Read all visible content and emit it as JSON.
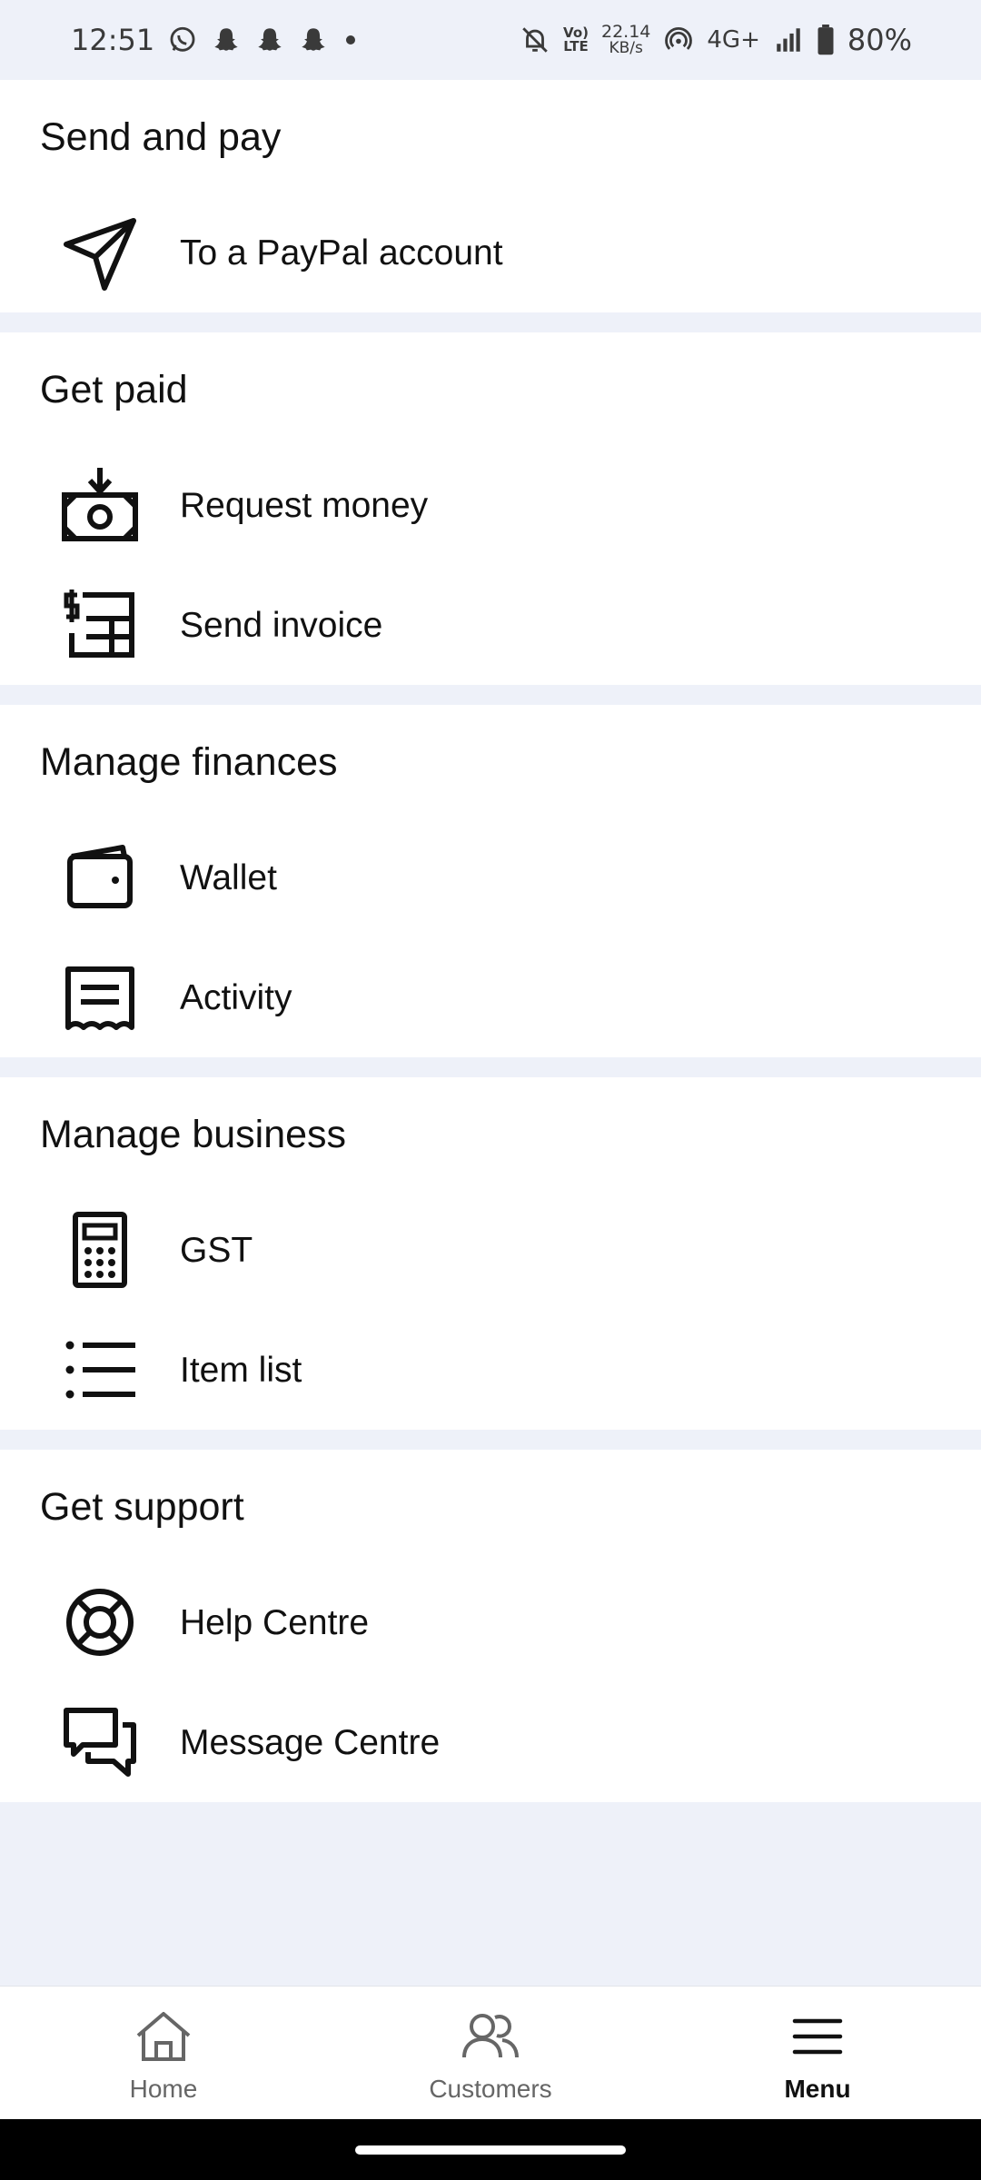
{
  "status_bar": {
    "time": "12:51",
    "battery": "80%",
    "network": "4G+",
    "speed_value": "22.14",
    "speed_unit": "KB/s",
    "volte_top": "Vo)",
    "volte_bottom": "LTE",
    "notification_icons": [
      "whatsapp-icon",
      "snapchat-icon",
      "snapchat-icon",
      "snapchat-icon",
      "dot-icon"
    ]
  },
  "sections": {
    "send_and_pay": {
      "title": "Send and pay",
      "items": [
        {
          "label": "To a PayPal account",
          "icon": "send-icon"
        }
      ]
    },
    "get_paid": {
      "title": "Get paid",
      "items": [
        {
          "label": "Request money",
          "icon": "request-money-icon"
        },
        {
          "label": "Send invoice",
          "icon": "invoice-icon"
        }
      ]
    },
    "manage_finances": {
      "title": "Manage finances",
      "items": [
        {
          "label": "Wallet",
          "icon": "wallet-icon"
        },
        {
          "label": "Activity",
          "icon": "receipt-icon"
        }
      ]
    },
    "manage_business": {
      "title": "Manage business",
      "items": [
        {
          "label": "GST",
          "icon": "calculator-icon"
        },
        {
          "label": "Item list",
          "icon": "list-icon"
        }
      ]
    },
    "get_support": {
      "title": "Get support",
      "items": [
        {
          "label": "Help Centre",
          "icon": "lifebuoy-icon"
        },
        {
          "label": "Message Centre",
          "icon": "chat-icon"
        }
      ]
    }
  },
  "bottom_nav": {
    "items": [
      {
        "label": "Home",
        "icon": "home-icon",
        "active": false
      },
      {
        "label": "Customers",
        "icon": "customers-icon",
        "active": false
      },
      {
        "label": "Menu",
        "icon": "menu-icon",
        "active": true
      }
    ]
  },
  "colors": {
    "page_background": "#eef1f9",
    "card_background": "#ffffff",
    "text": "#111111",
    "inactive_nav": "#666666"
  }
}
